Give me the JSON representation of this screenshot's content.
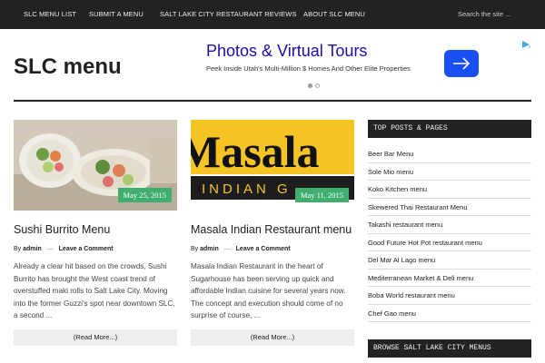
{
  "nav": {
    "items": [
      {
        "label": "SLC MENU LIST"
      },
      {
        "label": "SUBMIT A MENU"
      },
      {
        "label": "SALT LAKE CITY RESTAURANT REVIEWS"
      },
      {
        "label": "ABOUT SLC MENU"
      }
    ],
    "search_placeholder": "Search the site ..."
  },
  "site": {
    "title": "SLC menu"
  },
  "ad": {
    "headline": "Photos & Virtual Tours",
    "subtext": "Peek Inside Utah's Multi-Million $ Homes And Other Elite Properties",
    "button_icon": "arrow-right-icon",
    "accent_color": "#1a4ff5"
  },
  "posts": [
    {
      "title": "Sushi Burrito Menu",
      "date": "May 25, 2015",
      "by": "By",
      "author": "admin",
      "comment": "Leave a Comment",
      "excerpt": "Already a clear hit based on the crowds, Sushi Burrito has brought the West coast trend of overstuffed maki rolls to Salt Lake City. Moving into the former Guzzi's spot near downtown SLC, a second ...",
      "read_more": "(Read More...)",
      "image": "sushi-burrito-photo"
    },
    {
      "title": "Masala Indian Restaurant menu",
      "date": "May 11, 2015",
      "by": "By",
      "author": "admin",
      "comment": "Leave a Comment",
      "excerpt": "Masala Indian Restaurant in the heart of Sugarhouse has been serving up quick and affordable Indian cuisine for several years now. The concept and execution should come of no surprise of course, ...",
      "read_more": "(Read More...)",
      "image_text_top": "Masala",
      "image_text_bottom": "INDIAN G"
    }
  ],
  "sidebar": {
    "top_posts_title": "TOP POSTS & PAGES",
    "top_posts": [
      "Beer Bar Menu",
      "Sole Mio menu",
      "Koko Kitchen menu",
      "Skewered Thai Restaurant Menu",
      "Takashi restaurant menu",
      "Good Future Hot Pot restaurant menu",
      "Del Mar Al Lago menu",
      "Mediterranean Market & Deli menu",
      "Boba World restaurant menu",
      "Chef Gao menu"
    ],
    "browse_title": "BROWSE SALT LAKE CITY MENUS"
  },
  "colors": {
    "nav_bg": "#222222",
    "date_badge": "#3fae6f",
    "widget_bg": "#222222"
  }
}
